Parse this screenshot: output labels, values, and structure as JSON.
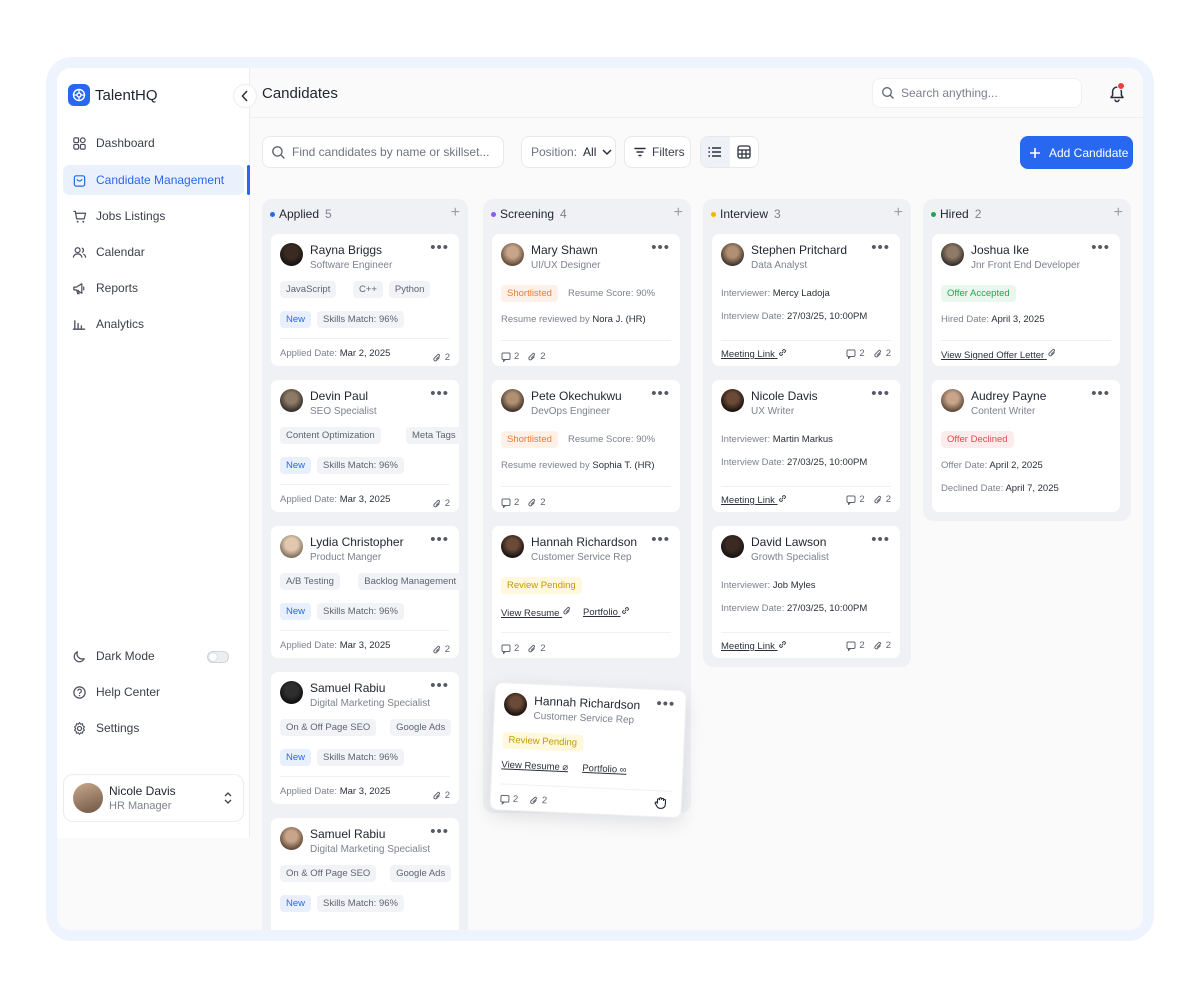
{
  "app": {
    "name": "TalentHQ"
  },
  "sidebar": {
    "items": [
      {
        "label": "Dashboard",
        "icon": "grid-icon"
      },
      {
        "label": "Candidate Management",
        "icon": "briefcase-icon",
        "active": true
      },
      {
        "label": "Jobs Listings",
        "icon": "cart-icon"
      },
      {
        "label": "Calendar",
        "icon": "users-icon"
      },
      {
        "label": "Reports",
        "icon": "megaphone-icon"
      },
      {
        "label": "Analytics",
        "icon": "bar-chart-icon"
      }
    ],
    "bottom": [
      {
        "label": "Dark Mode",
        "icon": "moon-icon"
      },
      {
        "label": "Help Center",
        "icon": "help-icon"
      },
      {
        "label": "Settings",
        "icon": "gear-icon"
      }
    ],
    "user": {
      "name": "Nicole Davis",
      "role": "HR Manager"
    }
  },
  "header": {
    "title": "Candidates",
    "search_placeholder": "Search anything..."
  },
  "toolbar": {
    "find_placeholder": "Find candidates by name or skillset...",
    "position_label": "Position:",
    "position_value": "All",
    "filters_label": "Filters",
    "add_label": "Add Candidate"
  },
  "columns": {
    "applied": {
      "title": "Applied",
      "count": "5",
      "color": "#2868f0"
    },
    "screening": {
      "title": "Screening",
      "count": "4",
      "color": "#8b5cf6"
    },
    "interview": {
      "title": "Interview",
      "count": "3",
      "color": "#f5b400"
    },
    "hired": {
      "title": "Hired",
      "count": "2",
      "color": "#23a455"
    }
  },
  "applied": [
    {
      "name": "Rayna Briggs",
      "role": "Software Engineer",
      "tags": [
        "JavaScript",
        "C++",
        "Python"
      ],
      "status": "New",
      "match": "Skills Match: 96%",
      "date_label": "Applied Date:",
      "date": "Mar 2, 2025",
      "attach": "2"
    },
    {
      "name": "Devin Paul",
      "role": "SEO Specialist",
      "tags": [
        "Content Optimization",
        "Meta Tags"
      ],
      "status": "New",
      "match": "Skills Match: 96%",
      "date_label": "Applied Date:",
      "date": "Mar 3, 2025",
      "attach": "2"
    },
    {
      "name": "Lydia Christopher",
      "role": "Product Manger",
      "tags": [
        "A/B Testing",
        "Backlog Management"
      ],
      "status": "New",
      "match": "Skills Match: 96%",
      "date_label": "Applied Date:",
      "date": "Mar 3, 2025",
      "attach": "2"
    },
    {
      "name": "Samuel Rabiu",
      "role": "Digital Marketing Specialist",
      "tags": [
        "On & Off Page SEO",
        "Google Ads"
      ],
      "status": "New",
      "match": "Skills Match: 96%",
      "date_label": "Applied Date:",
      "date": "Mar 3, 2025",
      "attach": "2"
    },
    {
      "name": "Samuel Rabiu",
      "role": "Digital Marketing Specialist",
      "tags": [
        "On & Off Page SEO",
        "Google Ads"
      ],
      "status": "New",
      "match": "Skills Match: 96%"
    }
  ],
  "screening": [
    {
      "name": "Mary Shawn",
      "role": "UI/UX Designer",
      "status": "Shortlisted",
      "score": "Resume Score: 90%",
      "reviewed_label": "Resume reviewed by",
      "reviewer": "Nora J. (HR)",
      "comments": "2",
      "attach": "2"
    },
    {
      "name": "Pete Okechukwu",
      "role": "DevOps Engineer",
      "status": "Shortlisted",
      "score": "Resume Score: 90%",
      "reviewed_label": "Resume reviewed by",
      "reviewer": "Sophia T. (HR)",
      "comments": "2",
      "attach": "2"
    },
    {
      "name": "Hannah Richardson",
      "role": "Customer Service Rep",
      "status": "Review Pending",
      "resume_link": "View Resume",
      "portfolio_link": "Portfolio",
      "comments": "2",
      "attach": "2"
    }
  ],
  "dragging": {
    "name": "Hannah Richardson",
    "role": "Customer Service Rep",
    "status": "Review Pending",
    "resume_link": "View Resume",
    "portfolio_link": "Portfolio",
    "comments": "2",
    "attach": "2"
  },
  "interview": [
    {
      "name": "Stephen Pritchard",
      "role": "Data Analyst",
      "interviewer_label": "Interviewer:",
      "interviewer": "Mercy Ladoja",
      "date_label": "Interview Date:",
      "date": "27/03/25, 10:00PM",
      "link": "Meeting Link",
      "comments": "2",
      "attach": "2"
    },
    {
      "name": "Nicole Davis",
      "role": "UX Writer",
      "interviewer_label": "Interviewer:",
      "interviewer": "Martin Markus",
      "date_label": "Interview Date:",
      "date": "27/03/25, 10:00PM",
      "link": "Meeting Link",
      "comments": "2",
      "attach": "2"
    },
    {
      "name": "David Lawson",
      "role": "Growth Specialist",
      "interviewer_label": "Interviewer:",
      "interviewer": "Job Myles",
      "date_label": "Interview Date:",
      "date": "27/03/25, 10:00PM",
      "link": "Meeting Link",
      "comments": "2",
      "attach": "2"
    }
  ],
  "hired": [
    {
      "name": "Joshua Ike",
      "role": "Jnr Front End Developer",
      "status": "Offer Accepted",
      "date_label": "Hired Date:",
      "date": "April 3, 2025",
      "link": "View Signed Offer Letter"
    },
    {
      "name": "Audrey Payne",
      "role": "Content Writer",
      "status": "Offer Declined",
      "date_label": "Offer Date:",
      "date": "April 2, 2025",
      "date2_label": "Declined Date:",
      "date2": "April 7, 2025"
    }
  ],
  "menu_glyph": "•••",
  "plus_glyph": "+"
}
